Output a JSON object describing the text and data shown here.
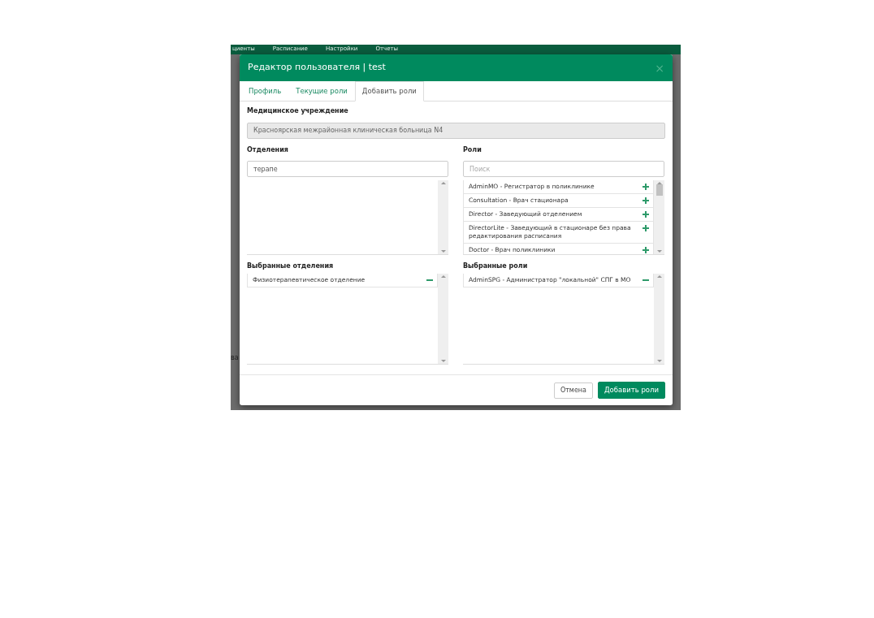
{
  "background_page": {
    "nav_items": [
      "циенты",
      "Расписание",
      "Настройки",
      "Отчеты"
    ],
    "side_text": "ва"
  },
  "dialog": {
    "title": "Редактор пользователя | test",
    "close": "×",
    "tabs": [
      {
        "label": "Профиль",
        "selected": false
      },
      {
        "label": "Текущие роли",
        "selected": false
      },
      {
        "label": "Добавить роли",
        "selected": true
      }
    ],
    "institution": {
      "label": "Медицинское учреждение",
      "value": "Красноярская межрайонная клиническая больница N4",
      "disabled": true
    },
    "departments": {
      "label": "Отделения",
      "value": "терапе"
    },
    "roles": {
      "label": "Роли",
      "placeholder": "Поиск",
      "items": [
        {
          "text": "AdminMO - Регистратор в поликлинике"
        },
        {
          "text": "Consultation - Врач стационара"
        },
        {
          "text": "Director - Заведующий отделением"
        },
        {
          "text": "DirectorLite - Заведующий в стационаре без права редактирования расписания"
        },
        {
          "text": "Doctor - Врач поликлиники"
        }
      ]
    },
    "selected_departments": {
      "label": "Выбранные отделения",
      "items": [
        {
          "text": "Физиотерапевтическое отделение"
        }
      ]
    },
    "selected_roles": {
      "label": "Выбранные роли",
      "items": [
        {
          "text": "AdminSPG - Администратор \"локальной\" СПГ в МО"
        }
      ]
    },
    "buttons": [
      {
        "label": "Отмена",
        "kind": "secondary"
      },
      {
        "label": "Добавить роли",
        "kind": "primary"
      }
    ]
  }
}
